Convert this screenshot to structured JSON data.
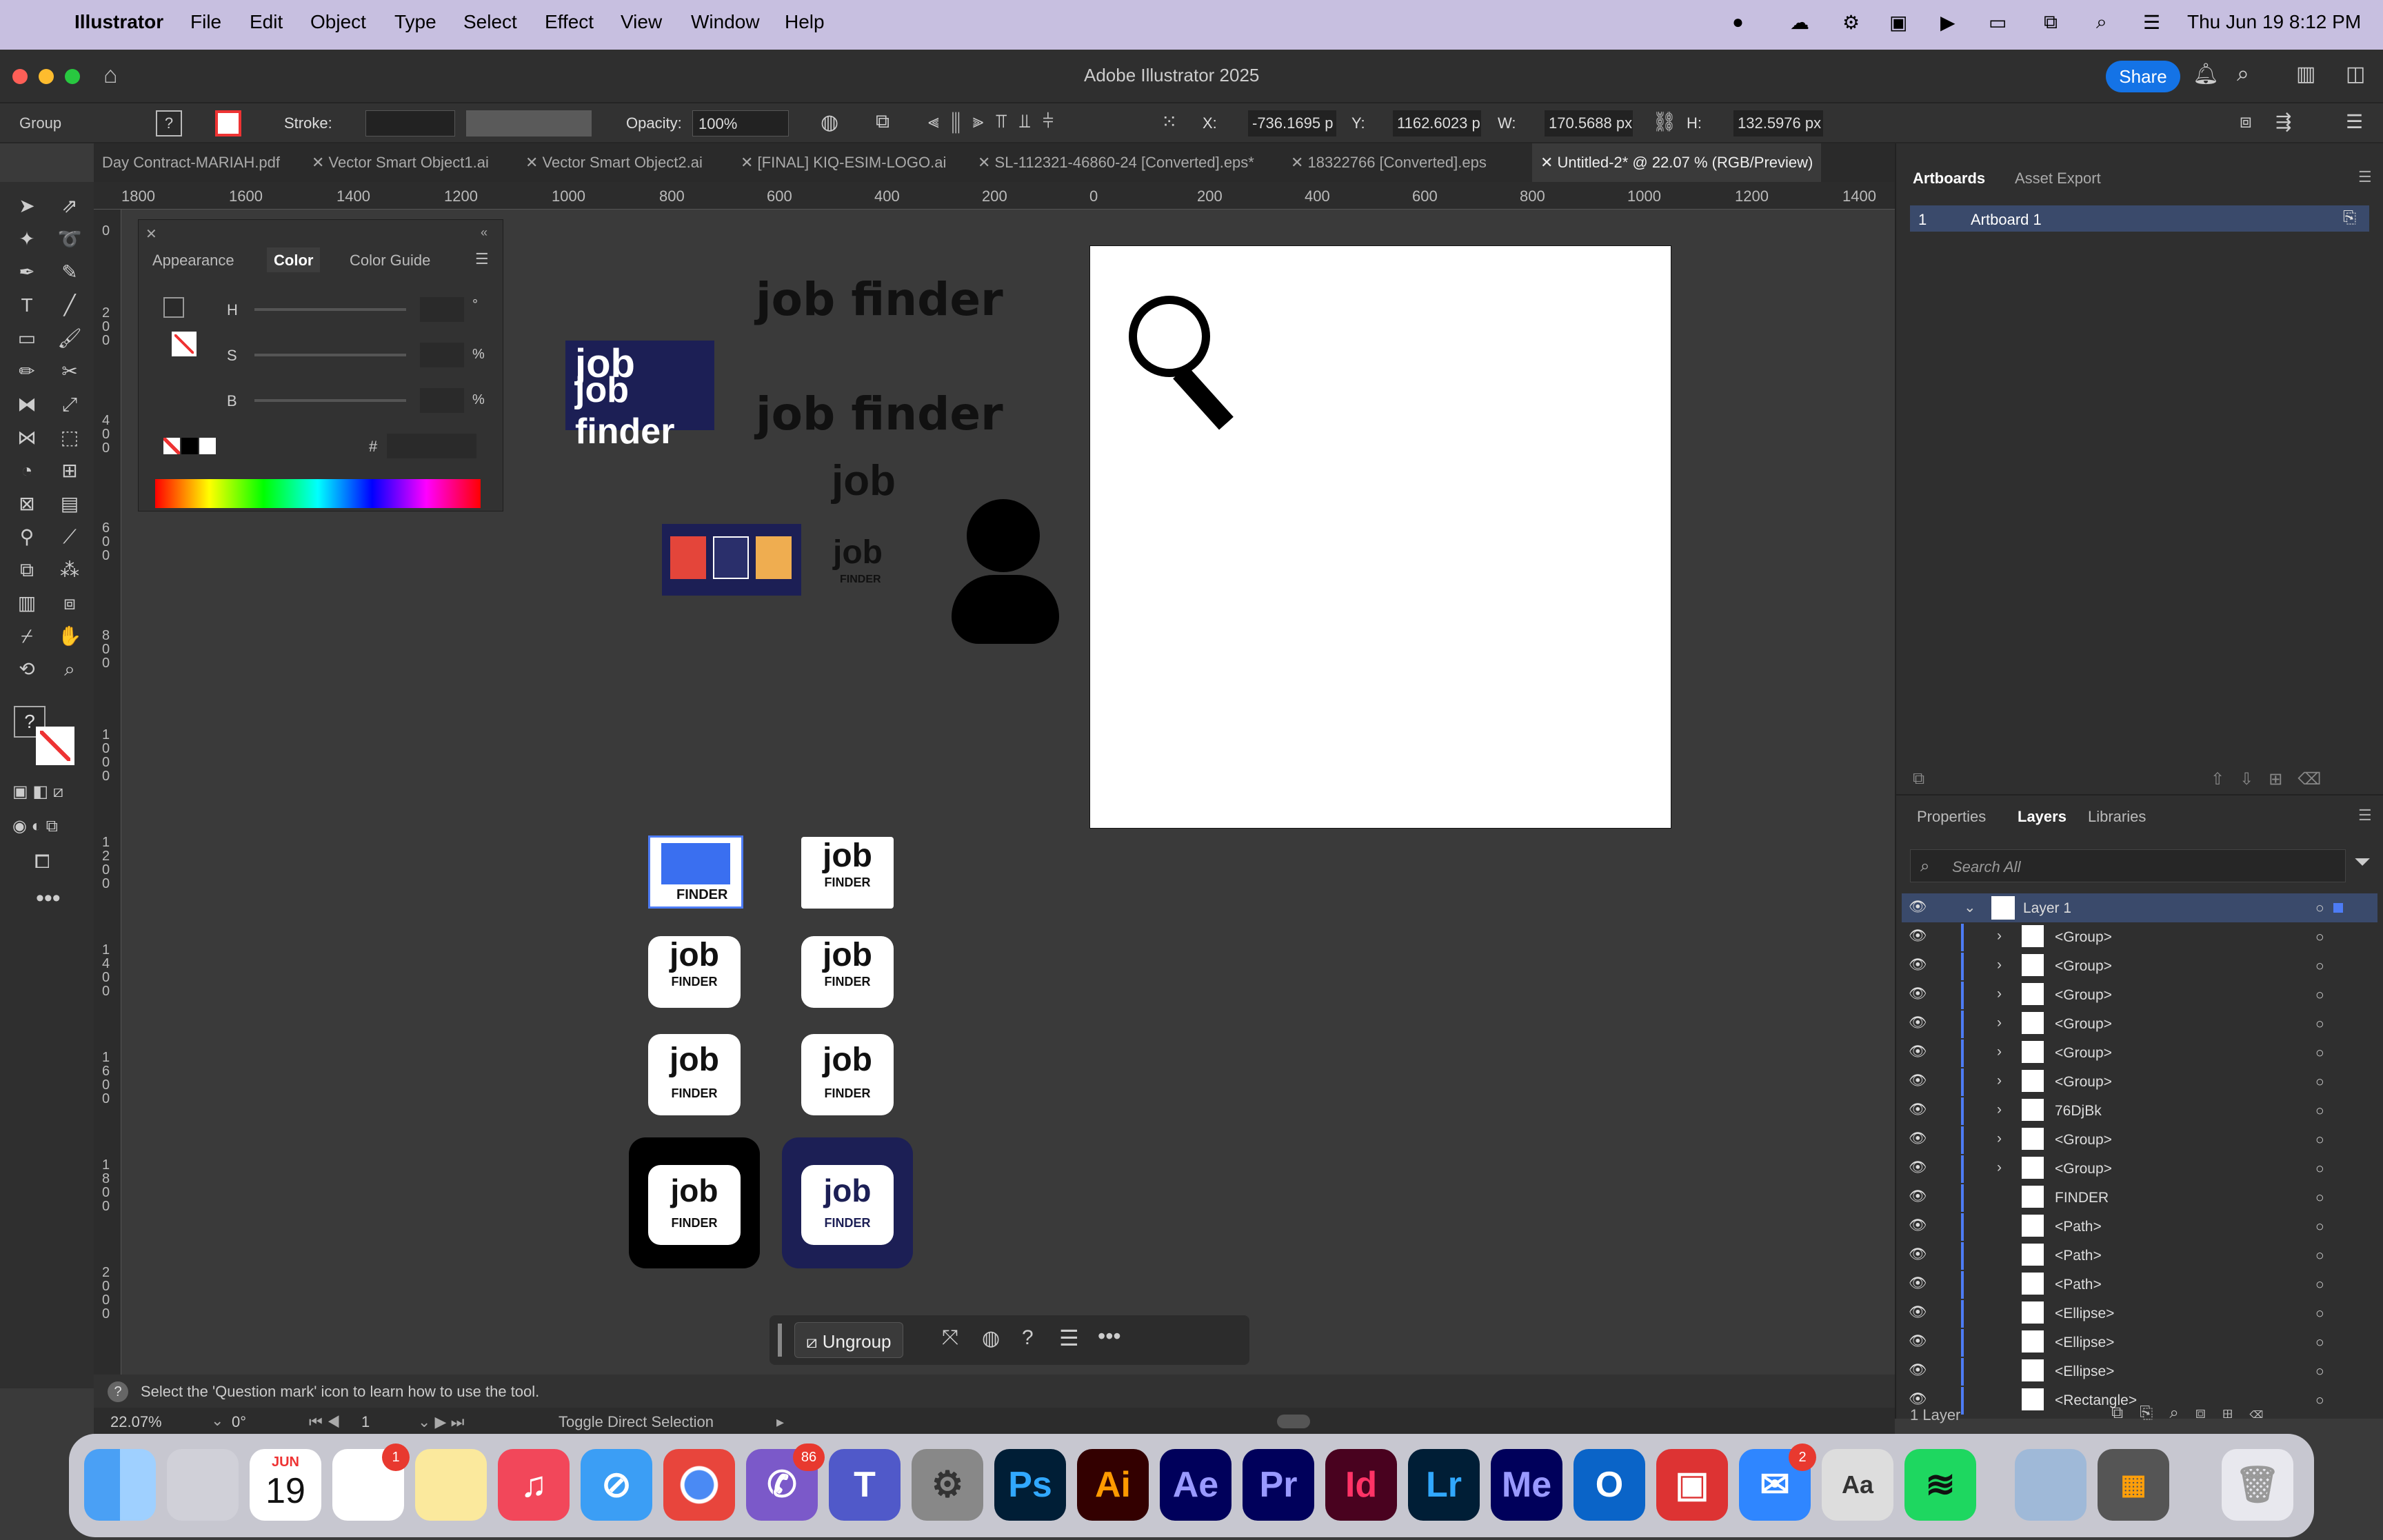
{
  "menubar": {
    "app": "Illustrator",
    "items": [
      "File",
      "Edit",
      "Object",
      "Type",
      "Select",
      "Effect",
      "View",
      "Window",
      "Help"
    ],
    "clock": "Thu Jun 19  8:12 PM"
  },
  "window": {
    "title": "Adobe Illustrator 2025",
    "share": "Share"
  },
  "control": {
    "selection": "Group",
    "stroke_label": "Stroke:",
    "opacity_label": "Opacity:",
    "opacity": "100%",
    "x_label": "X:",
    "x": "-736.1695 p",
    "y_label": "Y:",
    "y": "1162.6023 p",
    "w_label": "W:",
    "w": "170.5688 px",
    "h_label": "H:",
    "h": "132.5976 px"
  },
  "tabs": [
    "Day Contract-MARIAH.pdf",
    "Vector Smart Object1.ai",
    "Vector Smart Object2.ai",
    "[FINAL] KIQ-ESIM-LOGO.ai",
    "SL-112321-46860-24 [Converted].eps*",
    "18322766 [Converted].eps",
    "Untitled-2* @ 22.07 % (RGB/Preview)"
  ],
  "ruler_h": [
    "1800",
    "1600",
    "1400",
    "1200",
    "1000",
    "800",
    "600",
    "400",
    "200",
    "0",
    "200",
    "400",
    "600",
    "800",
    "1000",
    "1200",
    "1400"
  ],
  "ruler_v": [
    "0",
    "2 0 0",
    "4 0 0",
    "6 0 0",
    "8 0 0",
    "1 0 0 0",
    "1 2 0 0",
    "1 4 0 0",
    "1 6 0 0",
    "1 8 0 0",
    "2 0 0 0"
  ],
  "color_panel": {
    "tabs": [
      "Appearance",
      "Color",
      "Color Guide"
    ],
    "h": "H",
    "s": "S",
    "b": "B",
    "deg": "°",
    "pct": "%",
    "hash": "#"
  },
  "artwork": {
    "wordmark": "job finder",
    "job": "job",
    "finder": "FINDER"
  },
  "context": {
    "ungroup": "Ungroup"
  },
  "hint": "Select the 'Question mark' icon to learn how to use the tool.",
  "status": {
    "zoom": "22.07%",
    "angle": "0°",
    "artboard": "1",
    "tool": "Toggle Direct Selection"
  },
  "artboards_panel": {
    "tabs": [
      "Artboards",
      "Asset Export"
    ],
    "row_num": "1",
    "row_name": "Artboard 1"
  },
  "layers_panel": {
    "tabs": [
      "Properties",
      "Layers",
      "Libraries"
    ],
    "search": "Search All",
    "layer": "Layer 1",
    "footer": "1 Layer",
    "rows": [
      "<Group>",
      "<Group>",
      "<Group>",
      "<Group>",
      "<Group>",
      "<Group>",
      "76DjBk",
      "<Group>",
      "<Group>",
      "FINDER",
      "<Path>",
      "<Path>",
      "<Path>",
      "<Ellipse>",
      "<Ellipse>",
      "<Ellipse>",
      "<Rectangle>"
    ]
  },
  "dock": {
    "calendar_month": "JUN",
    "calendar_day": "19",
    "reminders_badge": "1",
    "viber_badge": "86",
    "messenger_badge": "2",
    "apps": [
      "Ps",
      "Ai",
      "Ae",
      "Pr",
      "Id",
      "Lr",
      "Me"
    ]
  },
  "colors": {
    "accent": "#1473e6",
    "navy": "#1c1f55"
  }
}
